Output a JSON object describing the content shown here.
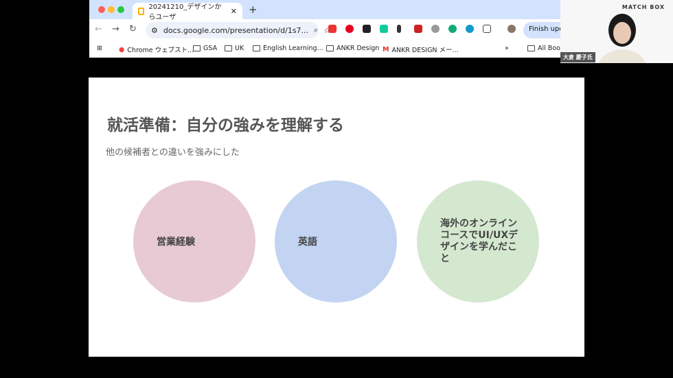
{
  "browser": {
    "tab_title": "20241210_デザインからユーザ",
    "url": "docs.google.com/presentation/d/1s7...",
    "finish_update": "Finish update",
    "bookmarks": [
      "Chrome ウェブスト...",
      "GSA",
      "UK",
      "English Learning...",
      "ANKR Design",
      "ANKR DESIGN メー...",
      "All Bookmarks"
    ]
  },
  "slide": {
    "title": "就活準備：自分の強みを理解する",
    "subtitle": "他の候補者との違いを強みにした",
    "circles": [
      {
        "label": "営業経験",
        "color": "#e8cad4"
      },
      {
        "label": "英語",
        "color": "#c3d4f2"
      },
      {
        "label": "海外のオンラインコースでUI/UXデザインを学んだこと",
        "color": "#d4e8d0"
      }
    ]
  },
  "webcam": {
    "logo": "MATCH BOX",
    "name": "大倉 慶子氏"
  }
}
